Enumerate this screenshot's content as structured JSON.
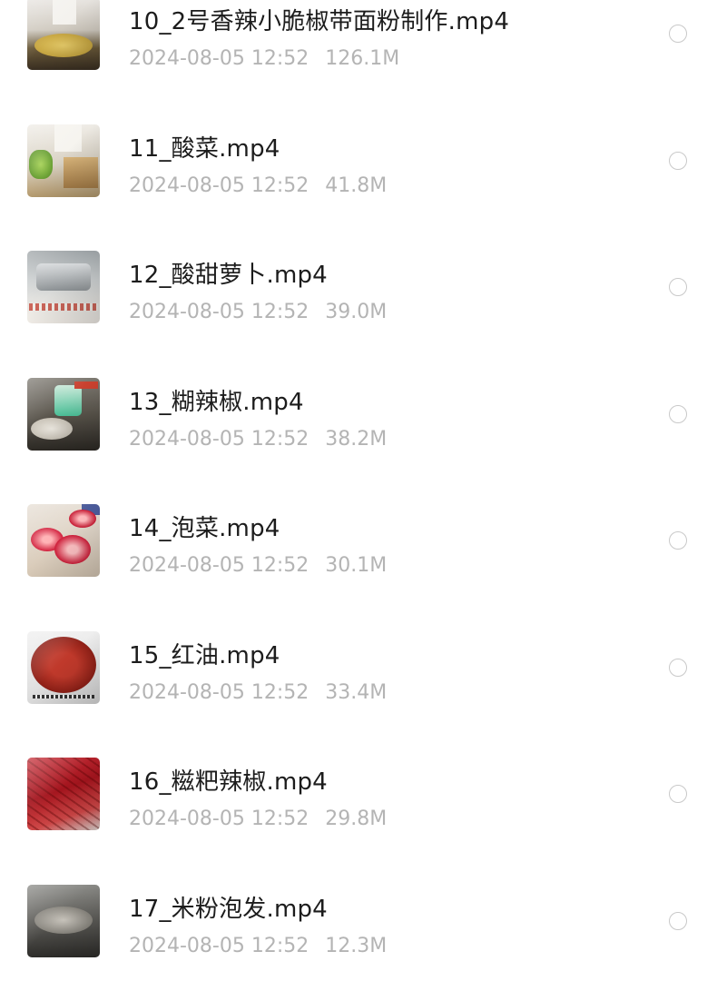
{
  "files": [
    {
      "name": "10_2号香辣小脆椒带面粉制作.mp4",
      "date": "2024-08-05 12:52",
      "size": "126.1M",
      "thumb": "chef-frying-pan-thumbnail"
    },
    {
      "name": "11_酸菜.mp4",
      "date": "2024-08-05 12:52",
      "size": "41.8M",
      "thumb": "pickled-greens-thumbnail"
    },
    {
      "name": "12_酸甜萝卜.mp4",
      "date": "2024-08-05 12:52",
      "size": "39.0M",
      "thumb": "kitchen-sink-thumbnail"
    },
    {
      "name": "13_糊辣椒.mp4",
      "date": "2024-08-05 12:52",
      "size": "38.2M",
      "thumb": "seasoning-bowl-thumbnail"
    },
    {
      "name": "14_泡菜.mp4",
      "date": "2024-08-05 12:52",
      "size": "30.1M",
      "thumb": "sliced-radish-thumbnail"
    },
    {
      "name": "15_红油.mp4",
      "date": "2024-08-05 12:52",
      "size": "33.4M",
      "thumb": "chili-oil-bowl-thumbnail"
    },
    {
      "name": "16_糍粑辣椒.mp4",
      "date": "2024-08-05 12:52",
      "size": "29.8M",
      "thumb": "dried-chili-thumbnail"
    },
    {
      "name": "17_米粉泡发.mp4",
      "date": "2024-08-05 12:52",
      "size": "12.3M",
      "thumb": "rice-noodle-pot-thumbnail"
    }
  ]
}
